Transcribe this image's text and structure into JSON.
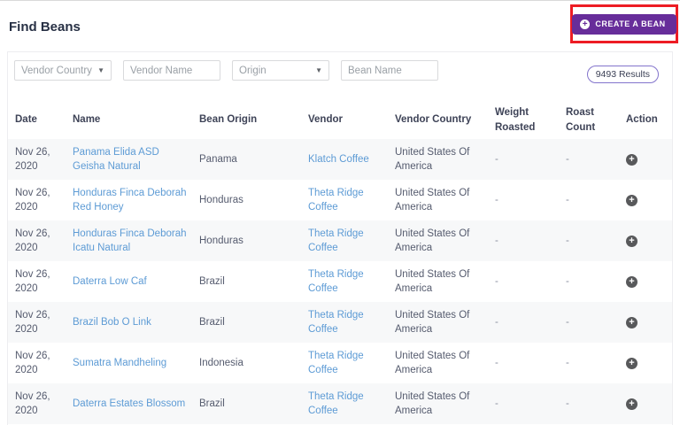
{
  "page": {
    "title": "Find Beans"
  },
  "create_button": {
    "label": "CREATE A BEAN",
    "icon": "plus-circle-icon"
  },
  "filters": {
    "vendor_country": {
      "placeholder": "Vendor Country"
    },
    "vendor_name": {
      "placeholder": "Vendor Name",
      "value": ""
    },
    "origin": {
      "placeholder": "Origin"
    },
    "bean_name": {
      "placeholder": "Bean Name",
      "value": ""
    }
  },
  "results_badge": {
    "label": "9493 Results"
  },
  "colors": {
    "accent_purple": "#672d9a",
    "annotation_red": "#ed1c24",
    "link_blue": "#5d9bd5",
    "row_stripe": "#f7f8f9"
  },
  "table": {
    "columns": [
      "Date",
      "Name",
      "Bean Origin",
      "Vendor",
      "Vendor Country",
      "Weight Roasted",
      "Roast Count",
      "Action"
    ],
    "rows": [
      {
        "date": "Nov 26, 2020",
        "name": "Panama Elida ASD Geisha Natural",
        "origin": "Panama",
        "vendor": "Klatch Coffee",
        "vendor_country": "United States Of America",
        "weight_roasted": "-",
        "roast_count": "-"
      },
      {
        "date": "Nov 26, 2020",
        "name": "Honduras Finca Deborah Red Honey",
        "origin": "Honduras",
        "vendor": "Theta Ridge Coffee",
        "vendor_country": "United States Of America",
        "weight_roasted": "-",
        "roast_count": "-"
      },
      {
        "date": "Nov 26, 2020",
        "name": "Honduras Finca Deborah Icatu Natural",
        "origin": "Honduras",
        "vendor": "Theta Ridge Coffee",
        "vendor_country": "United States Of America",
        "weight_roasted": "-",
        "roast_count": "-"
      },
      {
        "date": "Nov 26, 2020",
        "name": "Daterra Low Caf",
        "origin": "Brazil",
        "vendor": "Theta Ridge Coffee",
        "vendor_country": "United States Of America",
        "weight_roasted": "-",
        "roast_count": "-"
      },
      {
        "date": "Nov 26, 2020",
        "name": "Brazil Bob O Link",
        "origin": "Brazil",
        "vendor": "Theta Ridge Coffee",
        "vendor_country": "United States Of America",
        "weight_roasted": "-",
        "roast_count": "-"
      },
      {
        "date": "Nov 26, 2020",
        "name": "Sumatra Mandheling",
        "origin": "Indonesia",
        "vendor": "Theta Ridge Coffee",
        "vendor_country": "United States Of America",
        "weight_roasted": "-",
        "roast_count": "-"
      },
      {
        "date": "Nov 26, 2020",
        "name": "Daterra Estates Blossom",
        "origin": "Brazil",
        "vendor": "Theta Ridge Coffee",
        "vendor_country": "United States Of America",
        "weight_roasted": "-",
        "roast_count": "-"
      }
    ]
  }
}
